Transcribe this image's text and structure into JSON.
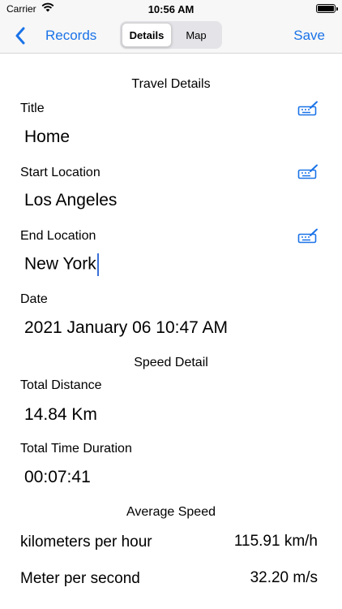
{
  "status_bar": {
    "carrier": "Carrier",
    "time": "10:56 AM"
  },
  "nav": {
    "back_label": "Records",
    "segments": [
      {
        "label": "Details",
        "selected": true
      },
      {
        "label": "Map",
        "selected": false
      }
    ],
    "save_label": "Save"
  },
  "travel": {
    "section_title": "Travel Details",
    "title_label": "Title",
    "title_value": "Home",
    "start_label": "Start Location",
    "start_value": "Los Angeles",
    "end_label": "End Location",
    "end_value": "New York",
    "date_label": "Date",
    "date_value": "2021 January 06 10:47 AM"
  },
  "speed": {
    "section_title": "Speed Detail",
    "distance_label": "Total Distance",
    "distance_value": "14.84 Km",
    "duration_label": "Total Time Duration",
    "duration_value": "00:07:41"
  },
  "average": {
    "section_title": "Average Speed",
    "rows": [
      {
        "label": "kilometers per hour",
        "value": "115.91 km/h"
      },
      {
        "label": "Meter per second",
        "value": "32.20 m/s"
      }
    ]
  },
  "colors": {
    "accent": "#1a73e8",
    "cursor": "#3a6fd8"
  },
  "icons": {
    "back": "chevron-left-icon",
    "edit": "keyboard-edit-icon",
    "wifi": "wifi-icon",
    "battery": "battery-icon"
  }
}
